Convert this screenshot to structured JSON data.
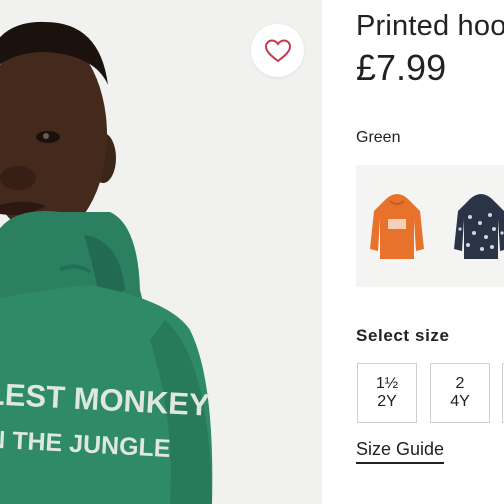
{
  "product": {
    "title": "Printed hoodie",
    "price": "£7.99",
    "favourite_icon": "heart-outline-icon",
    "hoodie_print_line1": "COOLEST MONKEY",
    "hoodie_print_line2": "IN THE JUNGLE"
  },
  "colour": {
    "selected_label": "Green",
    "swatches": [
      {
        "name": "orange-hoodie",
        "color": "#e8712b"
      },
      {
        "name": "navy-printed-hoodie",
        "color": "#2a3446"
      }
    ],
    "photo_hoodie_color": "#2f8a6a"
  },
  "size": {
    "label": "Select size",
    "options": [
      {
        "line1": "1½",
        "line2": "2Y"
      },
      {
        "line1": "2",
        "line2": "4Y"
      },
      {
        "line1": "",
        "line2": ""
      }
    ],
    "guide_label": "Size Guide"
  },
  "colors": {
    "heart": "#c8394f",
    "text": "#222222",
    "photo_bg": "#f1f1ef"
  }
}
